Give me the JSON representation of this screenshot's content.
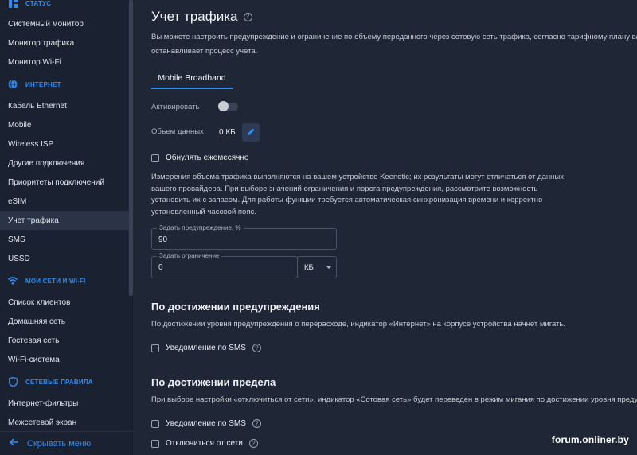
{
  "sidebar": {
    "status_header": "СТАТУС",
    "status_items": [
      "Системный монитор",
      "Монитор трафика",
      "Монитор Wi-Fi"
    ],
    "internet_header": "ИНТЕРНЕТ",
    "internet_items": [
      "Кабель Ethernet",
      "Mobile",
      "Wireless ISP",
      "Другие подключения",
      "Приоритеты подключений",
      "eSIM",
      "Учет трафика",
      "SMS",
      "USSD"
    ],
    "wifi_header": "МОИ СЕТИ И WI-FI",
    "wifi_items": [
      "Список клиентов",
      "Домашняя сеть",
      "Гостевая сеть",
      "Wi-Fi-система"
    ],
    "rules_header": "СЕТЕВЫЕ ПРАВИЛА",
    "rules_items": [
      "Интернет-фильтры",
      "Межсетевой экран"
    ],
    "hide_menu": "Скрывать меню"
  },
  "main": {
    "title": "Учет трафика",
    "description_line1": "Вы можете настроить предупреждение и ограничение по объему переданного через сотовую сеть трафика, согласно тарифному плану ваше",
    "description_line2": "останавливает процесс учета.",
    "tab": "Mobile Broadband",
    "activate_label": "Активировать",
    "data_volume_label": "Объем данных",
    "data_volume_value": "0 КБ",
    "reset_monthly": "Обнулять ежемесячно",
    "info_paragraph": "Измерения объема трафика выполняются на вашем устройстве Keenetic; их результаты могут отличаться от данных вашего провайдера. При выборе значений ограничения и порога предупреждения, рассмотрите возможность установить их с запасом. Для работы функции требуется автоматическая синхронизация времени и корректно установленный часовой пояс.",
    "warning_field_label": "Задать предупреждение, %",
    "warning_field_value": "90",
    "limit_field_label": "Задать ограничение",
    "limit_field_value": "0",
    "limit_unit": "КБ",
    "warning_section_title": "По достижении предупреждения",
    "warning_section_text": "По достижении уровня предупреждения о перерасходе, индикатор «Интернет» на корпусе устройства начнет мигать.",
    "sms_notify_1": "Уведомление по SMS",
    "limit_section_title": "По достижении предела",
    "limit_section_text": "При выборе настройки «отключиться от сети», индикатор «Сотовая сеть» будет переведен в режим мигания по достижении уровня предупрежде",
    "sms_notify_2": "Уведомление по SMS",
    "disconnect": "Отключиться от сети"
  },
  "watermark": "forum.onliner.by",
  "colors": {
    "accent": "#2f8cf2",
    "background": "#1f2736",
    "sidebar": "#1a2130"
  }
}
